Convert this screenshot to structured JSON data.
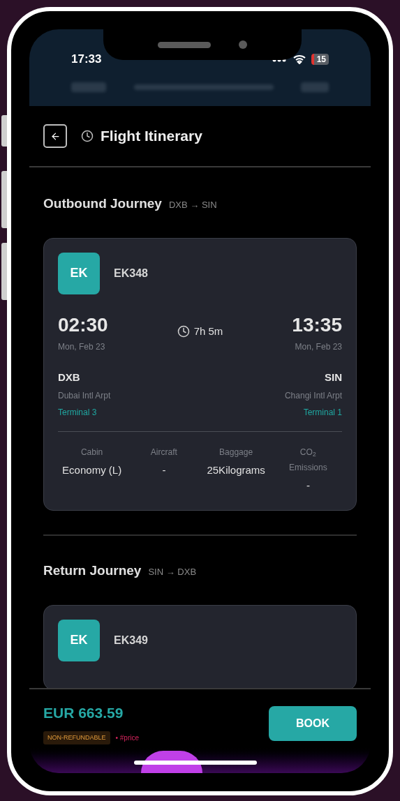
{
  "status_bar": {
    "time": "17:33",
    "battery": "15"
  },
  "header": {
    "title": "Flight Itinerary"
  },
  "journeys": [
    {
      "title": "Outbound Journey",
      "route": "DXB → SIN",
      "airline": "EK",
      "flight": "EK348",
      "depart": {
        "time": "02:30",
        "date": "Mon, Feb 23",
        "code": "DXB",
        "airport": "Dubai Intl Arpt",
        "terminal": "Terminal 3"
      },
      "duration": "7h 5m",
      "arrive": {
        "time": "13:35",
        "date": "Mon, Feb 23",
        "code": "SIN",
        "airport": "Changi Intl Arpt",
        "terminal": "Terminal 1"
      },
      "details": [
        {
          "label": "Cabin",
          "value": "Economy (L)"
        },
        {
          "label": "Aircraft",
          "value": "-"
        },
        {
          "label": "Baggage",
          "value": "25Kilograms"
        },
        {
          "label": "CO$_{2}$ Emissions",
          "value": "-"
        }
      ]
    },
    {
      "title": "Return Journey",
      "route": "SIN → DXB",
      "airline": "EK",
      "flight": "EK349"
    }
  ],
  "footer": {
    "price": "EUR 663.59",
    "tag": "NON-REFUNDABLE",
    "note": "• #price",
    "button": "BOOK"
  }
}
